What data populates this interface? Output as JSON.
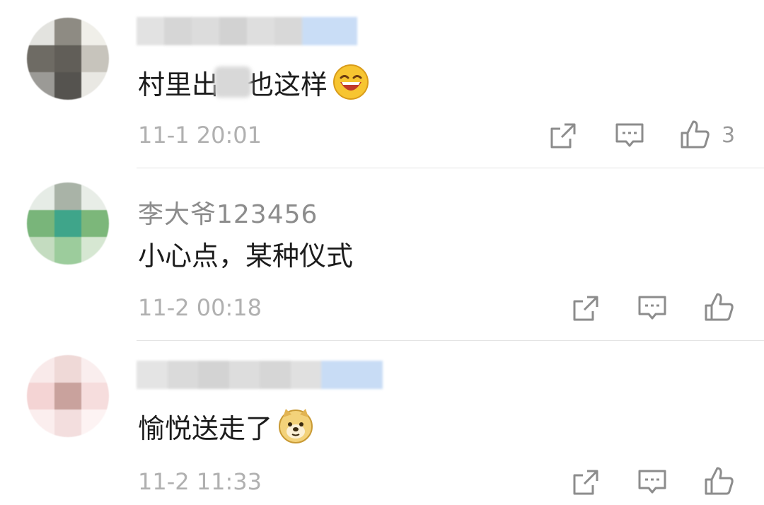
{
  "comments": [
    {
      "name": "",
      "text_before": "村里出",
      "text_after": "也这样",
      "emoji": "laughing-emoji",
      "time": "11-1 20:01",
      "likes": "3"
    },
    {
      "name": "李大爷123456",
      "text": "小心点，某种仪式",
      "time": "11-2 00:18",
      "likes": ""
    },
    {
      "name": "",
      "text": "愉悦送走了",
      "emoji": "doge-emoji",
      "time": "11-2 11:33",
      "likes": ""
    }
  ],
  "icons": {
    "share": "share-icon",
    "reply": "comment-icon",
    "like": "thumbs-up-icon"
  },
  "colors": {
    "text": "#1c1c1c",
    "meta": "#b0b0b0",
    "icon": "#8c8c8c",
    "divider": "#e4e4e4"
  }
}
